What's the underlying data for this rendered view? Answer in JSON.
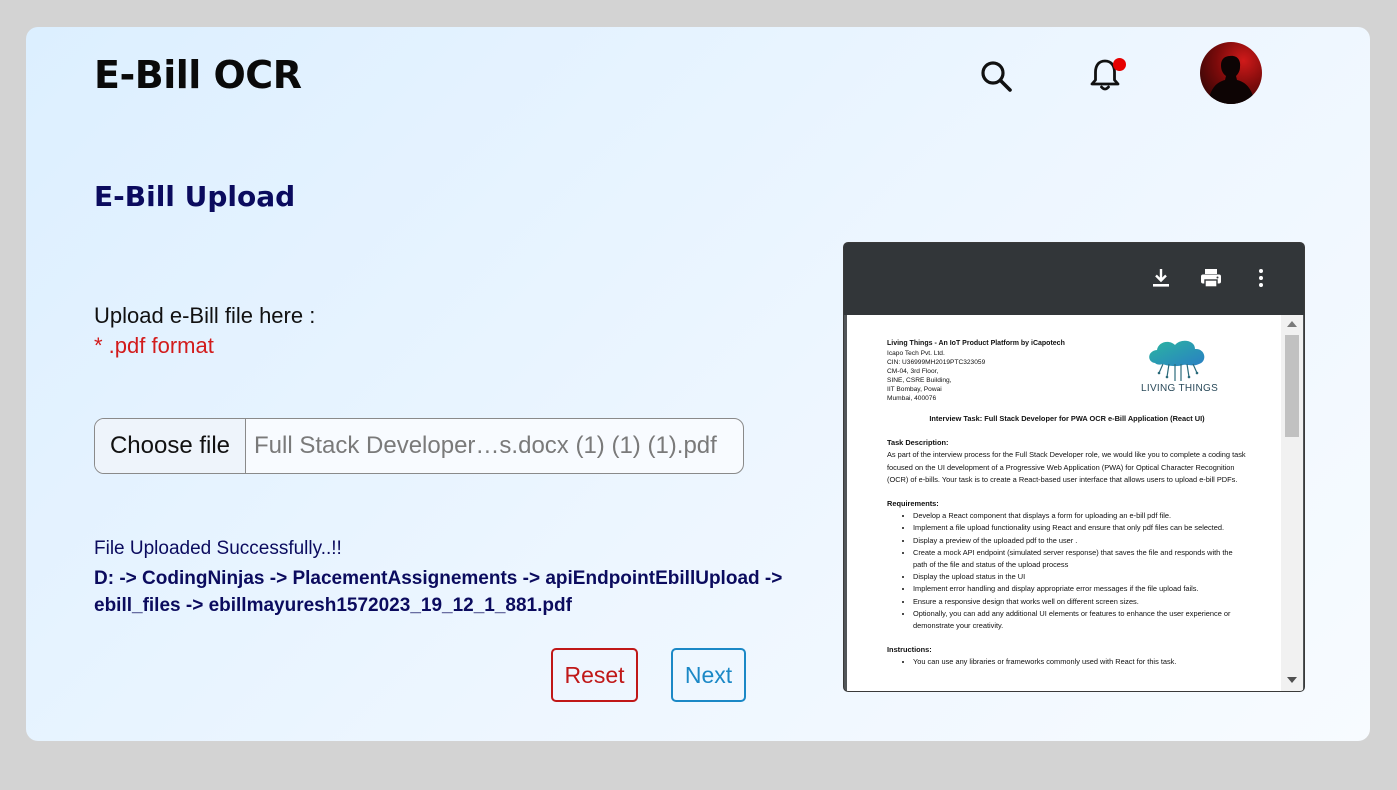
{
  "header": {
    "title": "E-Bill OCR",
    "icons": [
      "search-icon",
      "bell-icon",
      "avatar"
    ],
    "notification_dot_color": "#e60000"
  },
  "upload": {
    "section_title": "E-Bill Upload",
    "label": "Upload e-Bill file here :",
    "format_note": "* .pdf format",
    "choose_file_label": "Choose file",
    "file_name": "Full Stack Developer…s.docx (1) (1) (1).pdf",
    "status": "File Uploaded Successfully..!!",
    "path": "D: -> CodingNinjas -> PlacementAssignements -> apiEndpointEbillUpload -> ebill_files -> ebillmayuresh1572023_19_12_1_881.pdf",
    "reset_label": "Reset",
    "next_label": "Next",
    "colors": {
      "title": "#0b0b5e",
      "error": "#d21b1b",
      "reset": "#c01818",
      "next": "#1b88c6"
    }
  },
  "pdf_preview": {
    "toolbar_icons": [
      "download-icon",
      "print-icon",
      "more-vert-icon"
    ],
    "company": "Living Things - An IoT Product Platform by iCapotech",
    "address": [
      "Icapo Tech Pvt. Ltd.",
      "CIN: U36999MH2019PTC323059",
      "CM-04, 3rd Floor,",
      "SINE, CSRE Building,",
      "IIT Bombay, Powai",
      "Mumbai, 400076"
    ],
    "logo_text": "LIVING THINGS",
    "doc_title": "Interview Task: Full Stack Developer for PWA OCR e-Bill Application (React UI)",
    "task_heading": "Task Description:",
    "task_body": "As part of the interview process for the Full Stack Developer role, we would like you to complete a coding task focused on the UI development of a Progressive Web Application (PWA) for Optical Character Recognition (OCR) of e-bills. Your task is to create a React-based user interface that allows users to upload e-bill PDFs.",
    "requirements_heading": "Requirements:",
    "requirements": [
      "Develop a React component that displays a form for uploading an e-bill pdf file.",
      "Implement a file upload functionality using React and ensure that only pdf files can be selected.",
      "Display a preview of the uploaded pdf to the user .",
      "Create a mock API endpoint (simulated server response) that saves the file and responds with the path of the file and status of the upload process",
      "Display the upload status in the UI",
      "Implement error handling and display appropriate error messages if the file upload fails.",
      "Ensure a responsive design that works well on different screen sizes.",
      "Optionally, you can add any additional UI elements or features to enhance the user experience or demonstrate your creativity."
    ],
    "instructions_heading": "Instructions:",
    "instructions": [
      "You can use any libraries or frameworks commonly used with React for this task."
    ]
  }
}
